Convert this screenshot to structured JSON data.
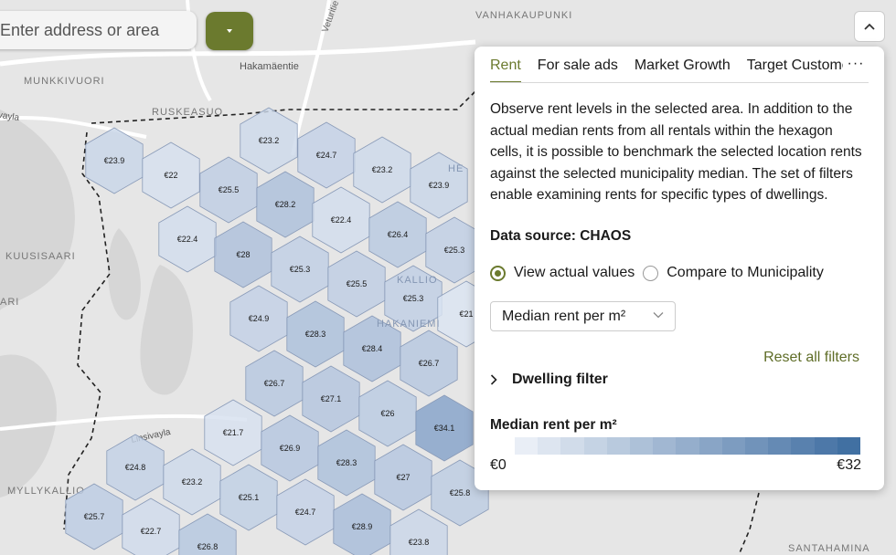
{
  "search": {
    "placeholder": "Enter address or area"
  },
  "map_labels": {
    "vanhakaupunki": "VANHAKAUPUNKI",
    "hakamaentie": "Hakamäentie",
    "veturitie": "Veturitie",
    "munkkivuori": "MUNKKIVUORI",
    "ruskeasuo": "RUSKEASUO",
    "kuusisaari": "KUUSISAARI",
    "ari": "ARI",
    "myllykallio": "MYLLYKALLIO",
    "santahamina": "SANTAHAMINA",
    "kallio": "KALLIO",
    "hakaniemi": "HAKANIEMI",
    "vayla": "uvayla",
    "nsivayla": "Linsivayla",
    "he": "HE"
  },
  "hexagons": [
    {
      "label": "€23.9",
      "value": 23.9
    },
    {
      "label": "€22",
      "value": 22
    },
    {
      "label": "€23.2",
      "value": 23.2
    },
    {
      "label": "€24.7",
      "value": 24.7
    },
    {
      "label": "€25.5",
      "value": 25.5
    },
    {
      "label": "€28.2",
      "value": 28.2
    },
    {
      "label": "€23.2",
      "value": 23.2
    },
    {
      "label": "€23.9",
      "value": 23.9
    },
    {
      "label": "€22.4",
      "value": 22.4
    },
    {
      "label": "€22.4",
      "value": 22.4
    },
    {
      "label": "€28",
      "value": 28
    },
    {
      "label": "€26.4",
      "value": 26.4
    },
    {
      "label": "€25.3",
      "value": 25.3
    },
    {
      "label": "€25.3",
      "value": 25.3
    },
    {
      "label": "€25.5",
      "value": 25.5
    },
    {
      "label": "€24.9",
      "value": 24.9
    },
    {
      "label": "€25.3",
      "value": 25.3
    },
    {
      "label": "€21",
      "value": 21
    },
    {
      "label": "€28.3",
      "value": 28.3
    },
    {
      "label": "€28.4",
      "value": 28.4
    },
    {
      "label": "€26.7",
      "value": 26.7
    },
    {
      "label": "€26.7",
      "value": 26.7
    },
    {
      "label": "€27.1",
      "value": 27.1
    },
    {
      "label": "€26",
      "value": 26
    },
    {
      "label": "€34.1",
      "value": 34.1
    },
    {
      "label": "€21.7",
      "value": 21.7
    },
    {
      "label": "€26.9",
      "value": 26.9
    },
    {
      "label": "€24.8",
      "value": 24.8
    },
    {
      "label": "€28.3",
      "value": 28.3
    },
    {
      "label": "€23.2",
      "value": 23.2
    },
    {
      "label": "€27",
      "value": 27
    },
    {
      "label": "€25.8",
      "value": 25.8
    },
    {
      "label": "€25.1",
      "value": 25.1
    },
    {
      "label": "€25.7",
      "value": 25.7
    },
    {
      "label": "€24.7",
      "value": 24.7
    },
    {
      "label": "€22.7",
      "value": 22.7
    },
    {
      "label": "€28.9",
      "value": 28.9
    },
    {
      "label": "€26.8",
      "value": 26.8
    },
    {
      "label": "€23.8",
      "value": 23.8
    }
  ],
  "panel": {
    "tabs": [
      {
        "label": "Rent",
        "active": true
      },
      {
        "label": "For sale ads",
        "active": false
      },
      {
        "label": "Market Growth",
        "active": false
      },
      {
        "label": "Target Customers",
        "active": false
      }
    ],
    "more_label": "···",
    "description": "Observe rent levels in the selected area. In addition to the actual median rents from all rentals within the hexagon cells, it is possible to benchmark the selected location rents against the selected municipality median. The set of filters enable examining rents for specific types of dwellings.",
    "data_source": "Data source: CHAOS",
    "radio_actual": "View actual values",
    "radio_compare": "Compare to Municipality",
    "radio_selected": "actual",
    "metric_select": "Median rent per m²",
    "reset_label": "Reset all filters",
    "dwelling_filter": "Dwelling filter",
    "legend_title": "Median rent per m²",
    "legend_min": "€0",
    "legend_max": "€32",
    "legend_colors": [
      "#e9eef6",
      "#dde5f0",
      "#d1dcea",
      "#c5d3e4",
      "#b9cade",
      "#adc1d8",
      "#a1b7d2",
      "#95aecc",
      "#89a5c6",
      "#7d9cc0",
      "#7193ba",
      "#658ab4",
      "#5981ae",
      "#4d78a8",
      "#4170a2"
    ]
  },
  "colors": {
    "accent": "#6b7a2e",
    "hex_stroke": "#8a9bb8",
    "hex_fill_low": "#e2e9f4",
    "hex_fill_high": "#7f9dc6"
  }
}
